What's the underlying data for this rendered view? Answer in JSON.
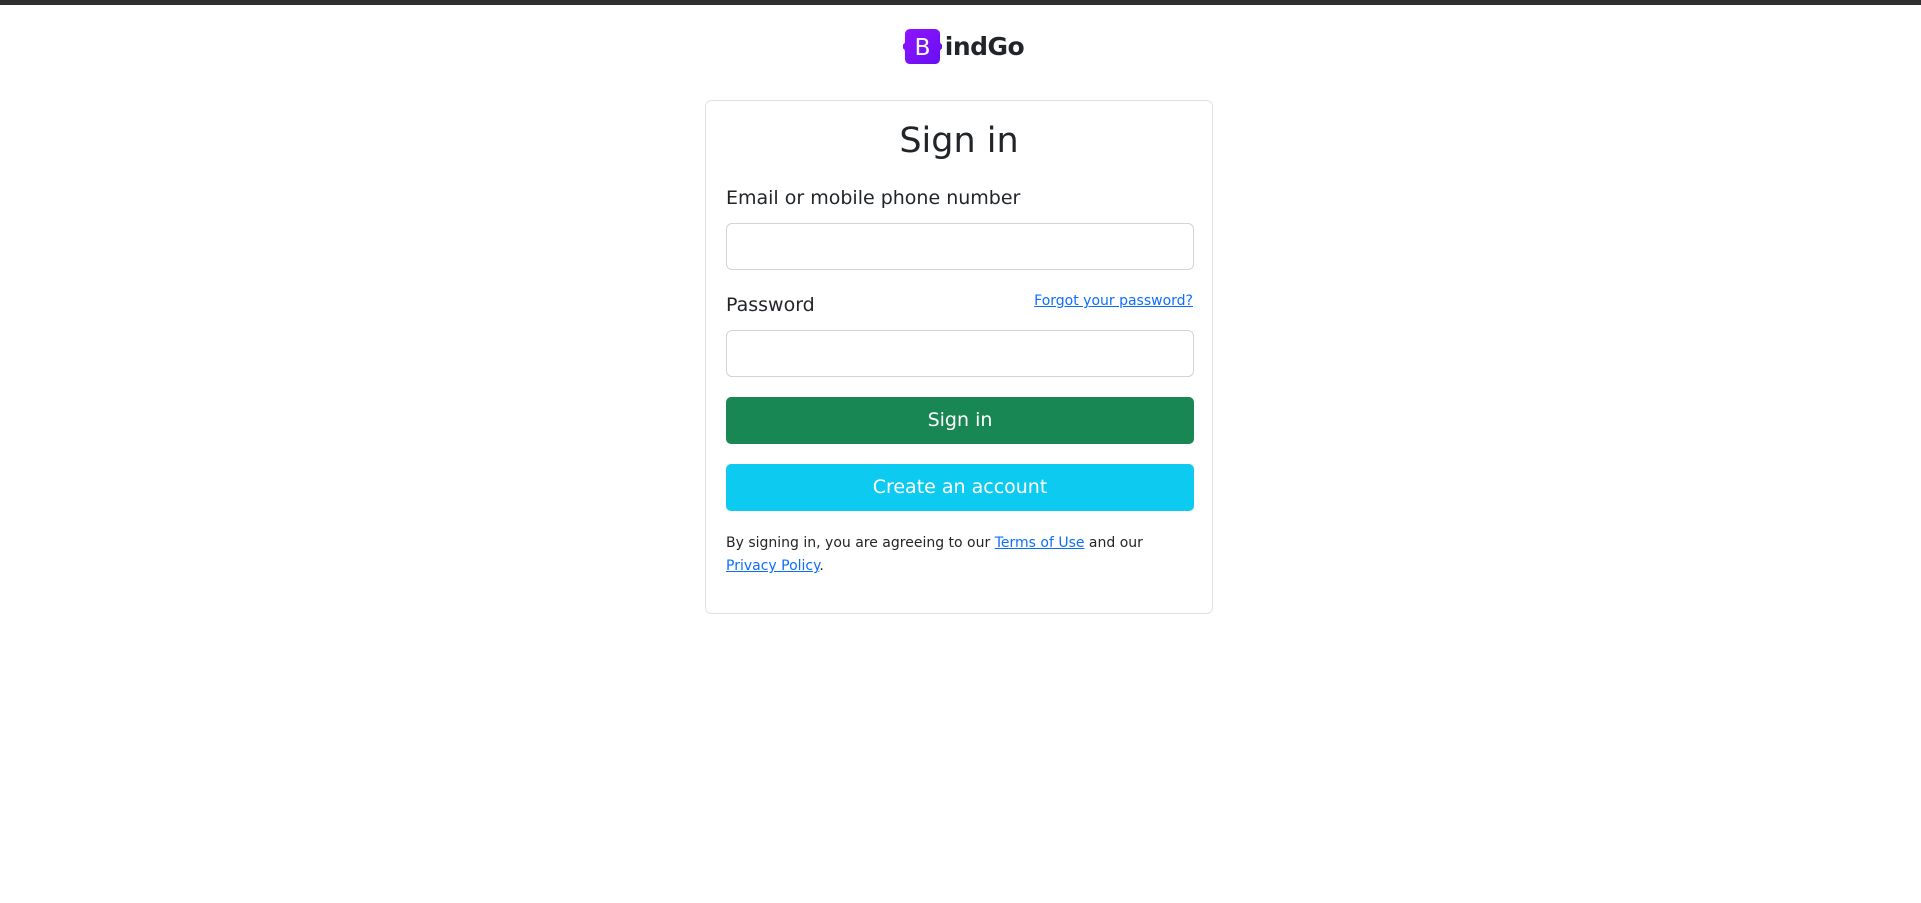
{
  "brand": {
    "logo_letter": "B",
    "name": "indGo",
    "logo_color": "#7952b3",
    "logo_icon": "bootstrap-logo-icon"
  },
  "card": {
    "title": "Sign in",
    "email_label": "Email or mobile phone number",
    "email_value": "",
    "password_label": "Password",
    "password_value": "",
    "forgot_link": "Forgot your password?",
    "signin_button": "Sign in",
    "create_button": "Create an account",
    "legal_prefix": "By signing in, you are agreeing to our ",
    "terms_link": "Terms of Use",
    "legal_middle": " and our ",
    "privacy_link": "Privacy Policy",
    "legal_suffix": "."
  },
  "colors": {
    "signin_button": "#198754",
    "create_button": "#0dcaf0",
    "link": "#0d6efd",
    "topbar": "#2f2f2f"
  }
}
